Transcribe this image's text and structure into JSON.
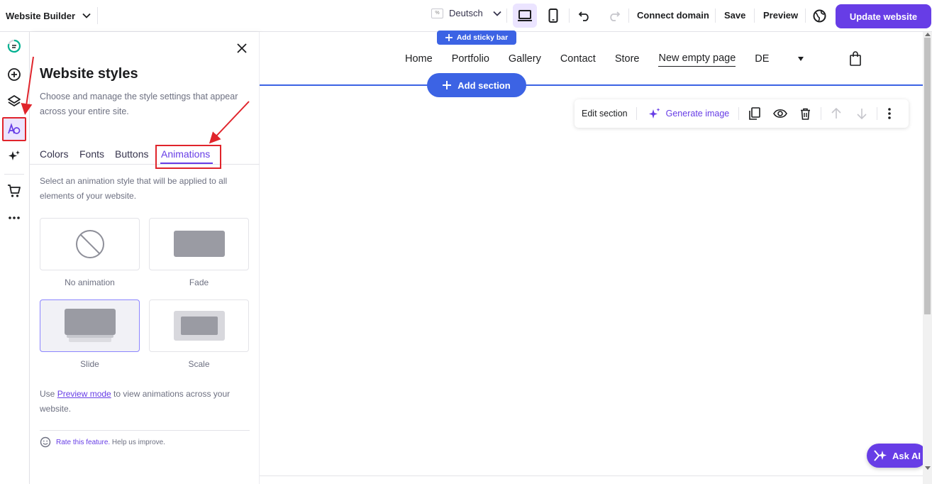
{
  "topbar": {
    "app_title": "Website Builder",
    "language": "Deutsch",
    "connect_domain": "Connect domain",
    "save": "Save",
    "preview": "Preview",
    "update_website": "Update website"
  },
  "panel": {
    "title": "Website styles",
    "description": "Choose and manage the style settings that appear across your entire site.",
    "tabs": [
      "Colors",
      "Fonts",
      "Buttons",
      "Animations"
    ],
    "active_tab": "Animations",
    "animation_description": "Select an animation style that will be applied to all elements of your website.",
    "options": [
      {
        "label": "No animation",
        "selected": false
      },
      {
        "label": "Fade",
        "selected": false
      },
      {
        "label": "Slide",
        "selected": true
      },
      {
        "label": "Scale",
        "selected": false
      }
    ],
    "preview_note_prefix": "Use ",
    "preview_note_link": "Preview mode",
    "preview_note_suffix": " to view animations across your website.",
    "rate_link": "Rate this feature.",
    "rate_suffix": " Help us improve."
  },
  "canvas": {
    "add_sticky_bar": "Add sticky bar",
    "nav_items": [
      "Home",
      "Portfolio",
      "Gallery",
      "Contact",
      "Store",
      "New empty page"
    ],
    "active_nav": "New empty page",
    "language_code": "DE",
    "add_section": "Add section",
    "edit_section": "Edit section",
    "generate_image": "Generate image",
    "ask_ai": "Ask AI"
  },
  "colors": {
    "accent": "#673de6",
    "accent_light": "#ebe4ff",
    "editor_blue": "#3c63e4",
    "annotation_red": "#e0242b"
  },
  "icons": {
    "rail": [
      "progress-icon",
      "add-element-icon",
      "layers-icon",
      "styles-icon",
      "ai-tools-icon",
      "store-icon",
      "more-icon"
    ],
    "edit_bar": [
      "duplicate-icon",
      "visibility-icon",
      "delete-icon",
      "move-up-icon",
      "move-down-icon",
      "more-options-icon"
    ]
  }
}
